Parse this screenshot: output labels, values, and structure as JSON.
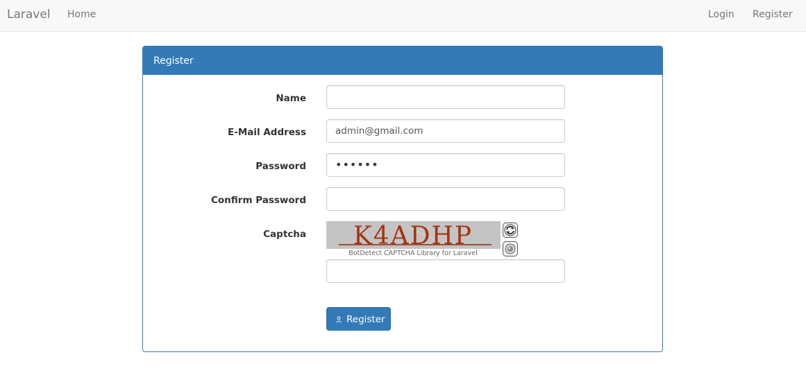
{
  "navbar": {
    "brand": "Laravel",
    "home": "Home",
    "login": "Login",
    "register": "Register"
  },
  "panel": {
    "heading": "Register"
  },
  "form": {
    "name_label": "Name",
    "name_value": "",
    "email_label": "E-Mail Address",
    "email_value": "admin@gmail.com",
    "password_label": "Password",
    "password_value": "••••••",
    "confirm_label": "Confirm Password",
    "confirm_value": "",
    "captcha_label": "Captcha",
    "captcha_text": "K4ADHP",
    "captcha_caption": "BotDetect CAPTCHA Library for Laravel",
    "captcha_input_value": "",
    "submit_label": "Register"
  },
  "icons": {
    "reload": "reload-icon",
    "sound": "speaker-icon",
    "submit": "user-icon"
  },
  "colors": {
    "primary": "#337ab7",
    "navbar_bg": "#f8f8f8",
    "captcha_text": "#a5330f",
    "captcha_bg": "#c4c4c4"
  }
}
